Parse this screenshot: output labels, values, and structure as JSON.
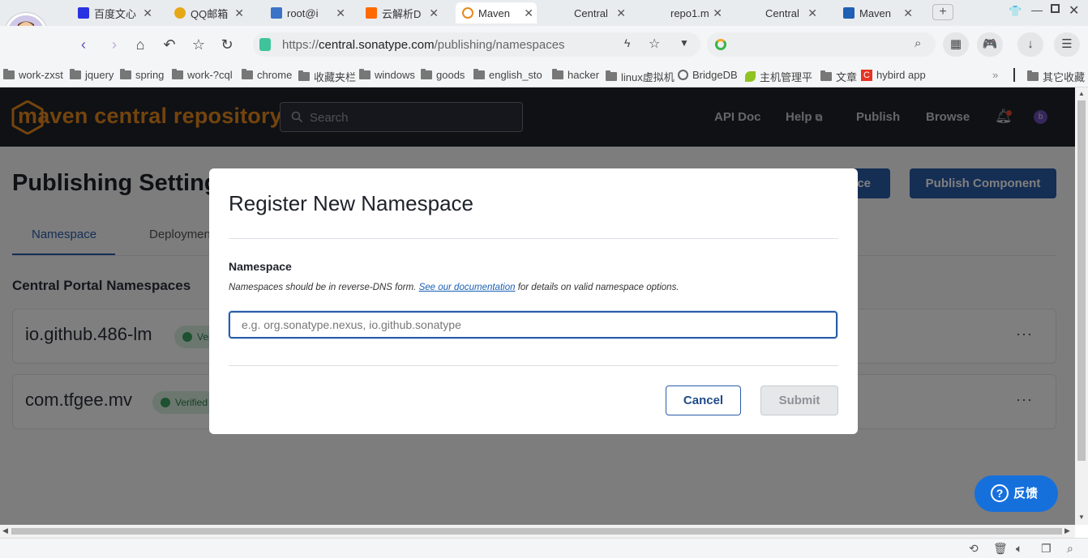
{
  "browser": {
    "tabs": [
      {
        "label": "百度文心",
        "color": "#2932e1"
      },
      {
        "label": "QQ邮箱",
        "color": "#e6a817"
      },
      {
        "label": "root@i",
        "color": "#3b73c7"
      },
      {
        "label": "云解析D",
        "color": "#ff6a00"
      },
      {
        "label": "Maven",
        "color": "#e8881c"
      },
      {
        "label": "Central",
        "color": "#999999"
      },
      {
        "label": "repo1.m",
        "color": "#999999"
      },
      {
        "label": "Central",
        "color": "#999999"
      },
      {
        "label": "Maven",
        "color": "#1f5fb4"
      }
    ],
    "url_prefix": "https://",
    "url_main": "central.sonatype.com",
    "url_path": "/publishing/namespaces",
    "bookmarks": [
      {
        "label": "work-zxst"
      },
      {
        "label": "jquery"
      },
      {
        "label": "spring"
      },
      {
        "label": "work-?cql"
      },
      {
        "label": "chrome"
      },
      {
        "label": "收藏夹栏"
      },
      {
        "label": "windows"
      },
      {
        "label": "goods"
      },
      {
        "label": "english_sto"
      },
      {
        "label": "hacker"
      },
      {
        "label": "linux虚拟机"
      },
      {
        "label": "BridgeDB"
      },
      {
        "label": "主机管理平"
      },
      {
        "label": "文章"
      },
      {
        "label": "hybird app"
      }
    ],
    "bookmarks_more": "»",
    "bookmarks_other": "其它收藏"
  },
  "site": {
    "logo": "maven central repository",
    "search_placeholder": "Search",
    "nav": [
      "API Doc",
      "Help",
      "Publish",
      "Browse"
    ],
    "avatar_letter": "b"
  },
  "page": {
    "title": "Publishing Settings",
    "btn_add_namespace_visible": "ce",
    "btn_publish_component": "Publish Component",
    "tabs": [
      "Namespace",
      "Deployments"
    ],
    "section_title": "Central Portal Namespaces",
    "namespaces": [
      {
        "name": "io.github.486-lm",
        "status": "Verified"
      },
      {
        "name": "com.tfgee.mv",
        "status": "Verified"
      }
    ],
    "more_icon": "···",
    "feedback_label": "反馈"
  },
  "modal": {
    "title": "Register New Namespace",
    "field_label": "Namespace",
    "help_prefix": "Namespaces should be in reverse-DNS form. ",
    "help_link": "See our documentation",
    "help_suffix": " for details on valid namespace options.",
    "input_placeholder": "e.g. org.sonatype.nexus, io.github.sonatype",
    "input_value": "",
    "cancel_label": "Cancel",
    "submit_label": "Submit"
  },
  "colors": {
    "brand_orange": "#e8881c",
    "primary_blue": "#2a5ca8",
    "header_dark": "#1f2229",
    "verified_green": "#3ba25f"
  }
}
